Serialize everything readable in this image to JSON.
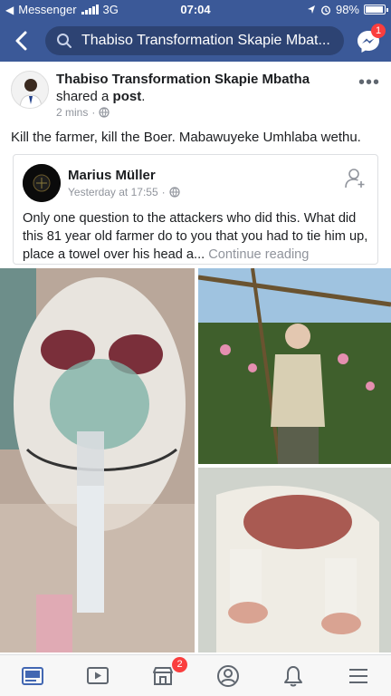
{
  "status_bar": {
    "carrier": "Messenger",
    "network": "3G",
    "time": "07:04",
    "battery": "98%",
    "icons": [
      "back-arrow-icon",
      "signal-bars-icon",
      "location-arrow-icon",
      "alarm-icon",
      "battery-icon"
    ]
  },
  "nav": {
    "search_text": "Thabiso Transformation Skapie Mbat...",
    "messenger_badge": "1",
    "icons": [
      "back-chevron-icon",
      "search-icon",
      "messenger-icon"
    ]
  },
  "post": {
    "author": "Thabiso Transformation Skapie Mbatha",
    "action": " shared a ",
    "action_link": "post",
    "action_end": ".",
    "time": "2 mins",
    "separator": "·",
    "text": "Kill the farmer,  kill the Boer. Mabawuyeke Umhlaba wethu.",
    "more": "•••"
  },
  "shared_post": {
    "author": "Marius Müller",
    "time": "Yesterday at 17:55",
    "separator": "·",
    "text": "Only one question to the attackers who did this. What did this 81 year old farmer do to you that you had to tie him up, place a towel over his head a...",
    "continue": " Continue reading"
  },
  "tabs": [
    {
      "name": "news-feed",
      "icon": "news-feed-icon"
    },
    {
      "name": "watch",
      "icon": "video-play-icon"
    },
    {
      "name": "marketplace",
      "icon": "marketplace-icon",
      "badge": "2"
    },
    {
      "name": "profile",
      "icon": "profile-icon"
    },
    {
      "name": "notifications",
      "icon": "bell-icon"
    },
    {
      "name": "menu",
      "icon": "hamburger-menu-icon"
    }
  ],
  "colors": {
    "brand": "#3b5998",
    "badge": "#fa3e3e",
    "active_tab": "#4267b2",
    "inactive_tab": "#606770"
  }
}
